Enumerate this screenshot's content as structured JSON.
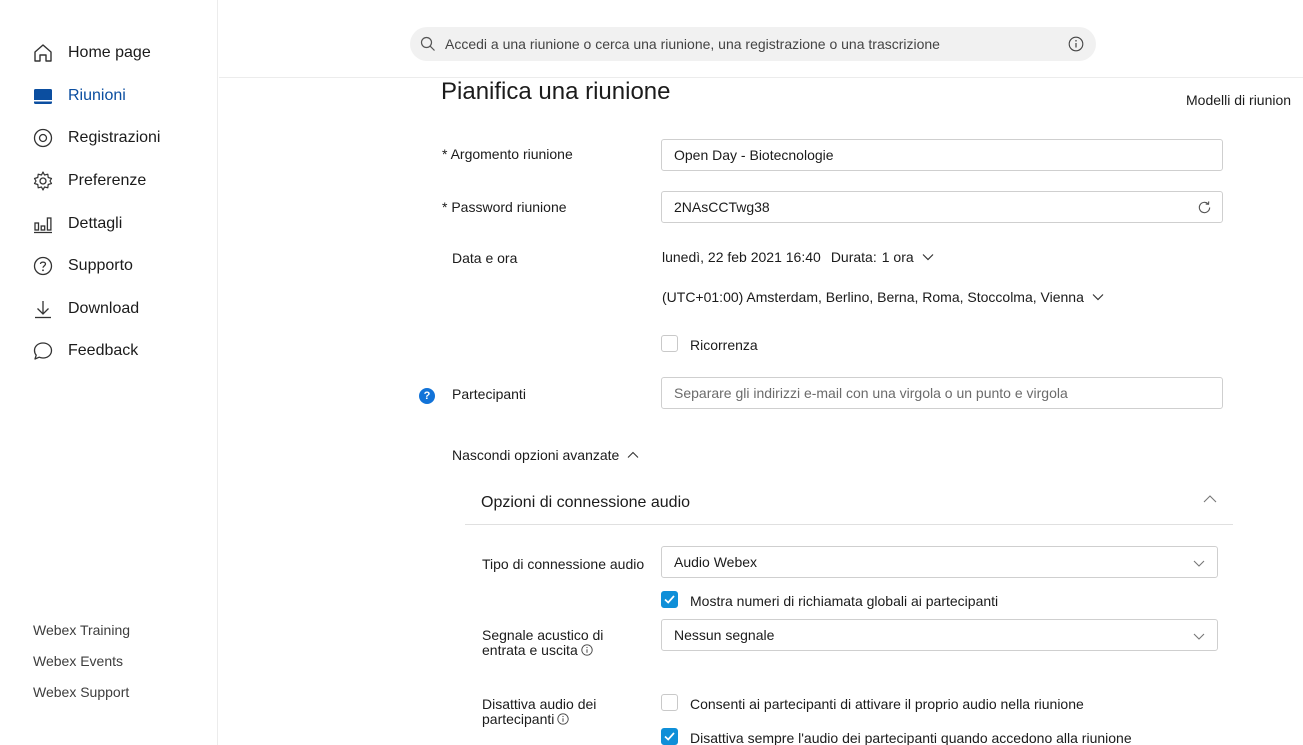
{
  "sidebar": {
    "items": [
      {
        "label": "Home page",
        "icon": "home-icon",
        "active": false
      },
      {
        "label": "Riunioni",
        "icon": "calendar-icon",
        "active": true
      },
      {
        "label": "Registrazioni",
        "icon": "recording-icon",
        "active": false
      },
      {
        "label": "Preferenze",
        "icon": "gear-icon",
        "active": false
      },
      {
        "label": "Dettagli",
        "icon": "bar-chart-icon",
        "active": false
      },
      {
        "label": "Supporto",
        "icon": "help-circle-icon",
        "active": false
      },
      {
        "label": "Download",
        "icon": "download-icon",
        "active": false
      },
      {
        "label": "Feedback",
        "icon": "chat-bubble-icon",
        "active": false
      }
    ],
    "footer_links": [
      "Webex Training",
      "Webex Events",
      "Webex Support"
    ],
    "active_color": "#0b4ea0"
  },
  "search": {
    "placeholder": "Accedi a una riunione o cerca una riunione, una registrazione o una trascrizione"
  },
  "page": {
    "title": "Pianifica una riunione",
    "templates_label": "Modelli di riunion"
  },
  "form": {
    "topic_label": "* Argomento riunione",
    "topic_value": "Open Day - Biotecnologie",
    "password_label": "* Password riunione",
    "password_value": "2NAsCCTwg38",
    "datetime_label": "Data e ora",
    "datetime_value": "lunedì, 22 feb 2021 16:40",
    "duration_label": "Durata:",
    "duration_value": "1 ora",
    "timezone_value": "(UTC+01:00) Amsterdam, Berlino, Berna, Roma, Stoccolma, Vienna",
    "recurrence_label": "Ricorrenza",
    "recurrence_checked": false,
    "attendees_label": "Partecipanti",
    "attendees_placeholder": "Separare gli indirizzi e-mail con una virgola o un punto e virgola",
    "advanced_toggle": "Nascondi opzioni avanzate"
  },
  "audio": {
    "section_title": "Opzioni di connessione audio",
    "type_label": "Tipo di connessione audio",
    "type_value": "Audio Webex",
    "show_callback_label": "Mostra numeri di richiamata globali ai partecipanti",
    "show_callback_checked": true,
    "tone_label_1": "Segnale acustico di",
    "tone_label_2": "entrata e uscita",
    "tone_value": "Nessun segnale",
    "mute_label_1": "Disattiva audio dei",
    "mute_label_2": "partecipanti",
    "allow_unmute_label": "Consenti ai partecipanti di attivare il proprio audio nella riunione",
    "allow_unmute_checked": false,
    "always_mute_label": "Disattiva sempre l'audio dei partecipanti quando accedono alla riunione",
    "always_mute_checked": true,
    "check_color": "#0f8fd8"
  }
}
